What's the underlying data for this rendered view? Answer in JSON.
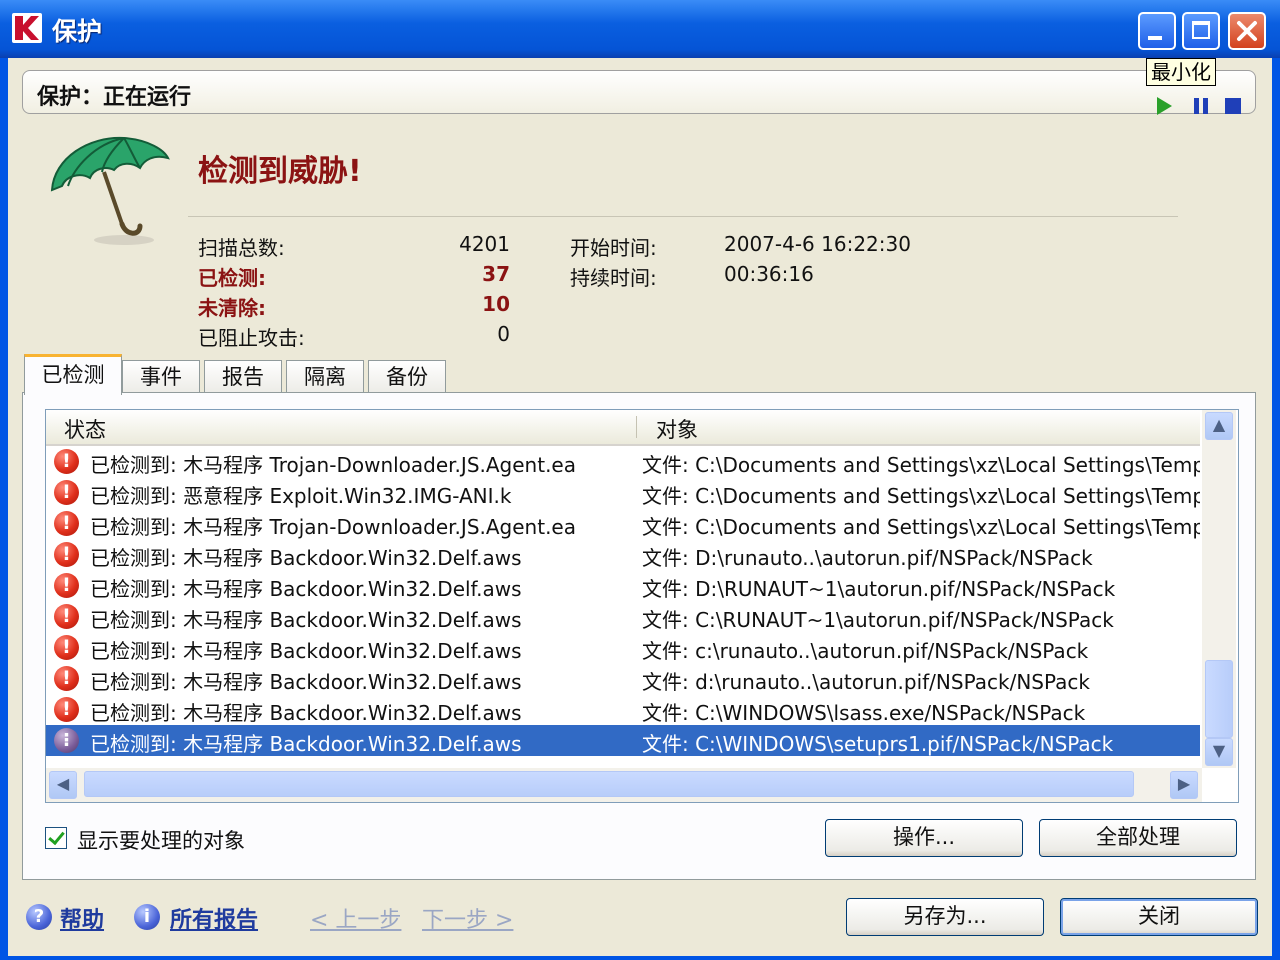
{
  "window": {
    "title": "保护",
    "tooltip": "最小化"
  },
  "status_bar": {
    "text": "保护：正在运行"
  },
  "headline": "检测到威胁!",
  "stats": {
    "scanned_label": "扫描总数:",
    "scanned_value": "4201",
    "detected_label": "已检测:",
    "detected_value": "37",
    "uncleaned_label": "未清除:",
    "uncleaned_value": "10",
    "blocked_label": "已阻止攻击:",
    "blocked_value": "0",
    "start_label": "开始时间:",
    "start_value": "2007-4-6 16:22:30",
    "duration_label": "持续时间:",
    "duration_value": "00:36:16"
  },
  "tabs": [
    {
      "label": "已检测"
    },
    {
      "label": "事件"
    },
    {
      "label": "报告"
    },
    {
      "label": "隔离"
    },
    {
      "label": "备份"
    }
  ],
  "table": {
    "headers": {
      "status": "状态",
      "object": "对象"
    },
    "rows": [
      {
        "status": "已检测到: 木马程序 Trojan-Downloader.JS.Agent.ea",
        "object": "文件: C:\\Documents and Settings\\xz\\Local Settings\\Tempor"
      },
      {
        "status": "已检测到: 恶意程序 Exploit.Win32.IMG-ANI.k",
        "object": "文件: C:\\Documents and Settings\\xz\\Local Settings\\Tempor"
      },
      {
        "status": "已检测到: 木马程序 Trojan-Downloader.JS.Agent.ea",
        "object": "文件: C:\\Documents and Settings\\xz\\Local Settings\\Tempor"
      },
      {
        "status": "已检测到: 木马程序 Backdoor.Win32.Delf.aws",
        "object": "文件: D:\\runauto..\\autorun.pif/NSPack/NSPack"
      },
      {
        "status": "已检测到: 木马程序 Backdoor.Win32.Delf.aws",
        "object": "文件: D:\\RUNAUT~1\\autorun.pif/NSPack/NSPack"
      },
      {
        "status": "已检测到: 木马程序 Backdoor.Win32.Delf.aws",
        "object": "文件: C:\\RUNAUT~1\\autorun.pif/NSPack/NSPack"
      },
      {
        "status": "已检测到: 木马程序 Backdoor.Win32.Delf.aws",
        "object": "文件: c:\\runauto..\\autorun.pif/NSPack/NSPack"
      },
      {
        "status": "已检测到: 木马程序 Backdoor.Win32.Delf.aws",
        "object": "文件: d:\\runauto..\\autorun.pif/NSPack/NSPack"
      },
      {
        "status": "已检测到: 木马程序 Backdoor.Win32.Delf.aws",
        "object": "文件: C:\\WINDOWS\\lsass.exe/NSPack/NSPack"
      },
      {
        "status": "已检测到: 木马程序 Backdoor.Win32.Delf.aws",
        "object": "文件: C:\\WINDOWS\\setuprs1.pif/NSPack/NSPack"
      }
    ]
  },
  "checkbox": {
    "label": "显示要处理的对象",
    "checked": true
  },
  "buttons": {
    "action": "操作...",
    "process_all": "全部处理",
    "save_as": "另存为...",
    "close": "关闭"
  },
  "footer": {
    "help": "帮助",
    "all_reports": "所有报告",
    "prev": "< 上一步",
    "next": "下一步 >"
  },
  "colors": {
    "title_bar": "#0554d6",
    "headline": "#8b1313",
    "selection": "#316ac5"
  }
}
